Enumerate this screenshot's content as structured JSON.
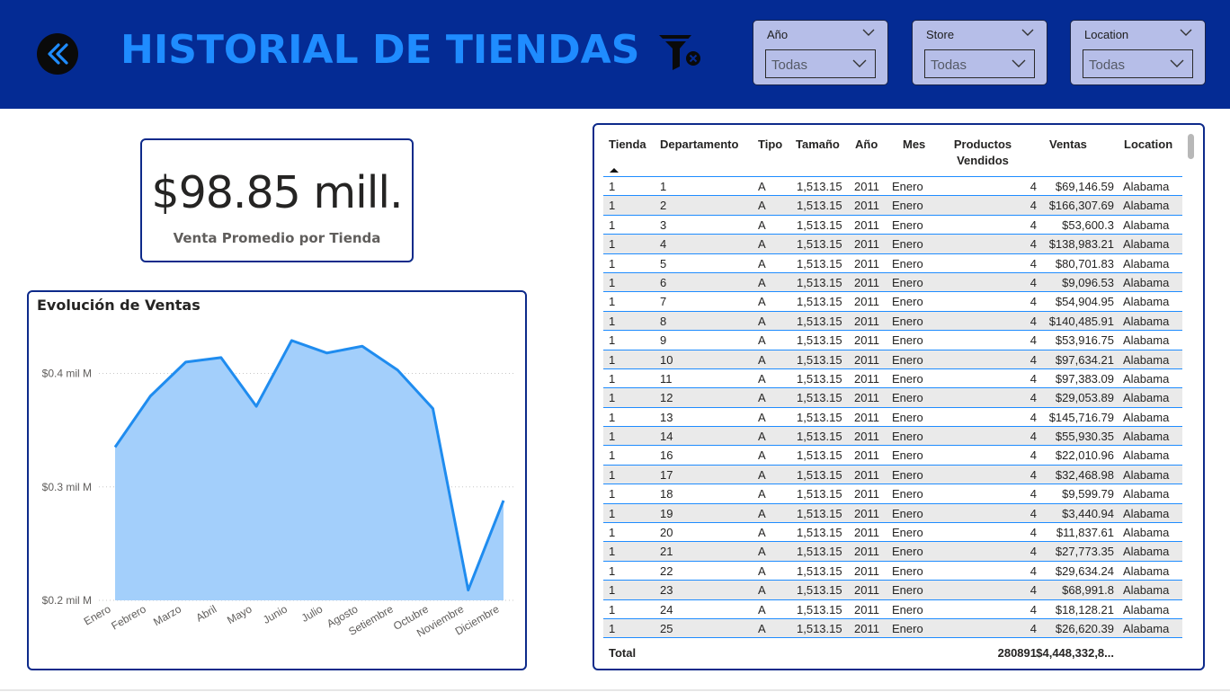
{
  "header": {
    "title": "HISTORIAL DE TIENDAS",
    "back_icon": "double-chevron-left-icon",
    "clear_filters_icon": "filter-clear-icon",
    "colors": {
      "band": "#042b94",
      "title": "#1f8cff",
      "slicer_bg": "#b6bee8"
    }
  },
  "slicers": [
    {
      "label": "Año",
      "value": "Todas"
    },
    {
      "label": "Store",
      "value": "Todas"
    },
    {
      "label": "Location",
      "value": "Todas"
    }
  ],
  "kpi": {
    "value": "$98.85 mill.",
    "label": "Venta Promedio por Tienda"
  },
  "chart_data": {
    "type": "area",
    "title": "Evolución de Ventas",
    "categories": [
      "Enero",
      "Febrero",
      "Marzo",
      "Abril",
      "Mayo",
      "Junio",
      "Julio",
      "Agosto",
      "Setiembre",
      "Octubre",
      "Noviembre",
      "Diciembre"
    ],
    "values": [
      0.335,
      0.38,
      0.41,
      0.414,
      0.371,
      0.429,
      0.418,
      0.424,
      0.403,
      0.369,
      0.209,
      0.288
    ],
    "y_ticks": [
      {
        "value": 0.2,
        "label": "$0.2 mil M"
      },
      {
        "value": 0.3,
        "label": "$0.3 mil M"
      },
      {
        "value": 0.4,
        "label": "$0.4 mil M"
      }
    ],
    "ylim": [
      0.2,
      0.44
    ],
    "grid": true,
    "colors": {
      "line": "#1f8cef",
      "fill": "#a3cffb"
    }
  },
  "table": {
    "columns": [
      "Tienda",
      "Departamento",
      "Tipo",
      "Tamaño",
      "Año",
      "Mes",
      "Productos\nVendidos",
      "Ventas",
      "Location"
    ],
    "rows": [
      [
        "1",
        "1",
        "A",
        "1,513.15",
        "2011",
        "Enero",
        "4",
        "$69,146.59",
        "Alabama"
      ],
      [
        "1",
        "2",
        "A",
        "1,513.15",
        "2011",
        "Enero",
        "4",
        "$166,307.69",
        "Alabama"
      ],
      [
        "1",
        "3",
        "A",
        "1,513.15",
        "2011",
        "Enero",
        "4",
        "$53,600.3",
        "Alabama"
      ],
      [
        "1",
        "4",
        "A",
        "1,513.15",
        "2011",
        "Enero",
        "4",
        "$138,983.21",
        "Alabama"
      ],
      [
        "1",
        "5",
        "A",
        "1,513.15",
        "2011",
        "Enero",
        "4",
        "$80,701.83",
        "Alabama"
      ],
      [
        "1",
        "6",
        "A",
        "1,513.15",
        "2011",
        "Enero",
        "4",
        "$9,096.53",
        "Alabama"
      ],
      [
        "1",
        "7",
        "A",
        "1,513.15",
        "2011",
        "Enero",
        "4",
        "$54,904.95",
        "Alabama"
      ],
      [
        "1",
        "8",
        "A",
        "1,513.15",
        "2011",
        "Enero",
        "4",
        "$140,485.91",
        "Alabama"
      ],
      [
        "1",
        "9",
        "A",
        "1,513.15",
        "2011",
        "Enero",
        "4",
        "$53,916.75",
        "Alabama"
      ],
      [
        "1",
        "10",
        "A",
        "1,513.15",
        "2011",
        "Enero",
        "4",
        "$97,634.21",
        "Alabama"
      ],
      [
        "1",
        "11",
        "A",
        "1,513.15",
        "2011",
        "Enero",
        "4",
        "$97,383.09",
        "Alabama"
      ],
      [
        "1",
        "12",
        "A",
        "1,513.15",
        "2011",
        "Enero",
        "4",
        "$29,053.89",
        "Alabama"
      ],
      [
        "1",
        "13",
        "A",
        "1,513.15",
        "2011",
        "Enero",
        "4",
        "$145,716.79",
        "Alabama"
      ],
      [
        "1",
        "14",
        "A",
        "1,513.15",
        "2011",
        "Enero",
        "4",
        "$55,930.35",
        "Alabama"
      ],
      [
        "1",
        "16",
        "A",
        "1,513.15",
        "2011",
        "Enero",
        "4",
        "$22,010.96",
        "Alabama"
      ],
      [
        "1",
        "17",
        "A",
        "1,513.15",
        "2011",
        "Enero",
        "4",
        "$32,468.98",
        "Alabama"
      ],
      [
        "1",
        "18",
        "A",
        "1,513.15",
        "2011",
        "Enero",
        "4",
        "$9,599.79",
        "Alabama"
      ],
      [
        "1",
        "19",
        "A",
        "1,513.15",
        "2011",
        "Enero",
        "4",
        "$3,440.94",
        "Alabama"
      ],
      [
        "1",
        "20",
        "A",
        "1,513.15",
        "2011",
        "Enero",
        "4",
        "$11,837.61",
        "Alabama"
      ],
      [
        "1",
        "21",
        "A",
        "1,513.15",
        "2011",
        "Enero",
        "4",
        "$27,773.35",
        "Alabama"
      ],
      [
        "1",
        "22",
        "A",
        "1,513.15",
        "2011",
        "Enero",
        "4",
        "$29,634.24",
        "Alabama"
      ],
      [
        "1",
        "23",
        "A",
        "1,513.15",
        "2011",
        "Enero",
        "4",
        "$68,991.8",
        "Alabama"
      ],
      [
        "1",
        "24",
        "A",
        "1,513.15",
        "2011",
        "Enero",
        "4",
        "$18,128.21",
        "Alabama"
      ],
      [
        "1",
        "25",
        "A",
        "1,513.15",
        "2011",
        "Enero",
        "4",
        "$26,620.39",
        "Alabama"
      ]
    ],
    "total": {
      "label": "Total",
      "productos": "280891",
      "ventas": "$4,448,332,8..."
    },
    "sort_icon": "sort-ascending-icon"
  }
}
